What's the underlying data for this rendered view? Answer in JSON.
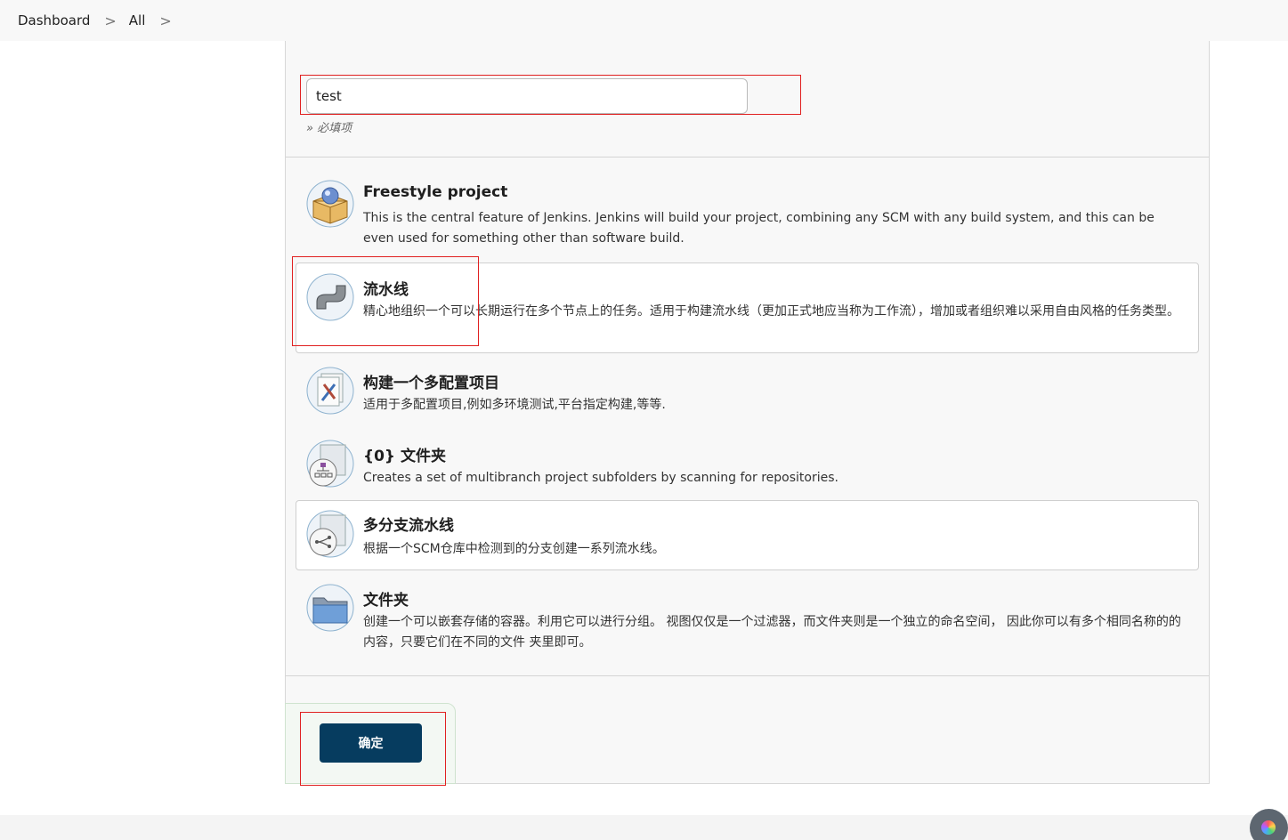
{
  "breadcrumb": {
    "items": [
      "Dashboard",
      "All"
    ],
    "separator": ">"
  },
  "name_field": {
    "value": "test",
    "hint": "» 必填项"
  },
  "items": [
    {
      "title": "Freestyle project",
      "desc": "This is the central feature of Jenkins. Jenkins will build your project, combining any SCM with any build system, and this can be even used for something other than software build.",
      "icon": "freestyle-box-icon"
    },
    {
      "title": "流水线",
      "desc": "精心地组织一个可以长期运行在多个节点上的任务。适用于构建流水线（更加正式地应当称为工作流），增加或者组织难以采用自由风格的任务类型。",
      "icon": "pipeline-icon"
    },
    {
      "title": "构建一个多配置项目",
      "desc": "适用于多配置项目,例如多环境测试,平台指定构建,等等.",
      "icon": "multi-config-icon"
    },
    {
      "title": "{0} 文件夹",
      "desc": "Creates a set of multibranch project subfolders by scanning for repositories.",
      "icon": "org-folder-icon"
    },
    {
      "title": "多分支流水线",
      "desc": "根据一个SCM仓库中检测到的分支创建一系列流水线。",
      "icon": "multibranch-icon"
    },
    {
      "title": "文件夹",
      "desc": "创建一个可以嵌套存储的容器。利用它可以进行分组。 视图仅仅是一个过滤器，而文件夹则是一个独立的命名空间， 因此你可以有多个相同名称的的内容，只要它们在不同的文件 夹里即可。",
      "icon": "folder-icon"
    }
  ],
  "confirm_button": {
    "label": "确定"
  },
  "colors": {
    "button": "#063c5f",
    "highlight_box": "#e02020",
    "panel_bg": "#f8f8f8"
  }
}
